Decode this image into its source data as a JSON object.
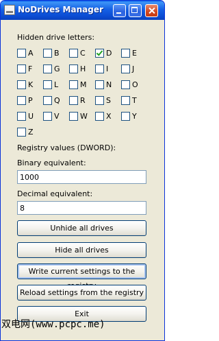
{
  "window": {
    "title": "NoDrives Manager"
  },
  "labels": {
    "hidden_drive_letters": "Hidden drive letters:",
    "registry_values": "Registry values (DWORD):",
    "binary_equivalent": "Binary equivalent:",
    "decimal_equivalent": "Decimal equivalent:"
  },
  "drives": [
    {
      "letter": "A",
      "checked": false
    },
    {
      "letter": "B",
      "checked": false
    },
    {
      "letter": "C",
      "checked": false
    },
    {
      "letter": "D",
      "checked": true
    },
    {
      "letter": "E",
      "checked": false
    },
    {
      "letter": "F",
      "checked": false
    },
    {
      "letter": "G",
      "checked": false
    },
    {
      "letter": "H",
      "checked": false
    },
    {
      "letter": "I",
      "checked": false
    },
    {
      "letter": "J",
      "checked": false
    },
    {
      "letter": "K",
      "checked": false
    },
    {
      "letter": "L",
      "checked": false
    },
    {
      "letter": "M",
      "checked": false
    },
    {
      "letter": "N",
      "checked": false
    },
    {
      "letter": "O",
      "checked": false
    },
    {
      "letter": "P",
      "checked": false
    },
    {
      "letter": "Q",
      "checked": false
    },
    {
      "letter": "R",
      "checked": false
    },
    {
      "letter": "S",
      "checked": false
    },
    {
      "letter": "T",
      "checked": false
    },
    {
      "letter": "U",
      "checked": false
    },
    {
      "letter": "V",
      "checked": false
    },
    {
      "letter": "W",
      "checked": false
    },
    {
      "letter": "X",
      "checked": false
    },
    {
      "letter": "Y",
      "checked": false
    },
    {
      "letter": "Z",
      "checked": false
    }
  ],
  "fields": {
    "binary_value": "1000",
    "decimal_value": "8"
  },
  "buttons": {
    "unhide_all": "Unhide all drives",
    "hide_all": "Hide all drives",
    "write_registry": "Write current settings to the registry",
    "reload_registry": "Reload settings from the registry",
    "exit": "Exit"
  },
  "watermark": "双电网(www.pcpc.me)",
  "colors": {
    "titlebar": "#1561E5",
    "window_bg": "#ECE9D8",
    "check_mark": "#21A121",
    "button_border": "#003C74"
  },
  "icons": {
    "app": "drive-window-icon",
    "minimize": "minimize-icon",
    "maximize": "maximize-icon",
    "close": "close-icon"
  }
}
